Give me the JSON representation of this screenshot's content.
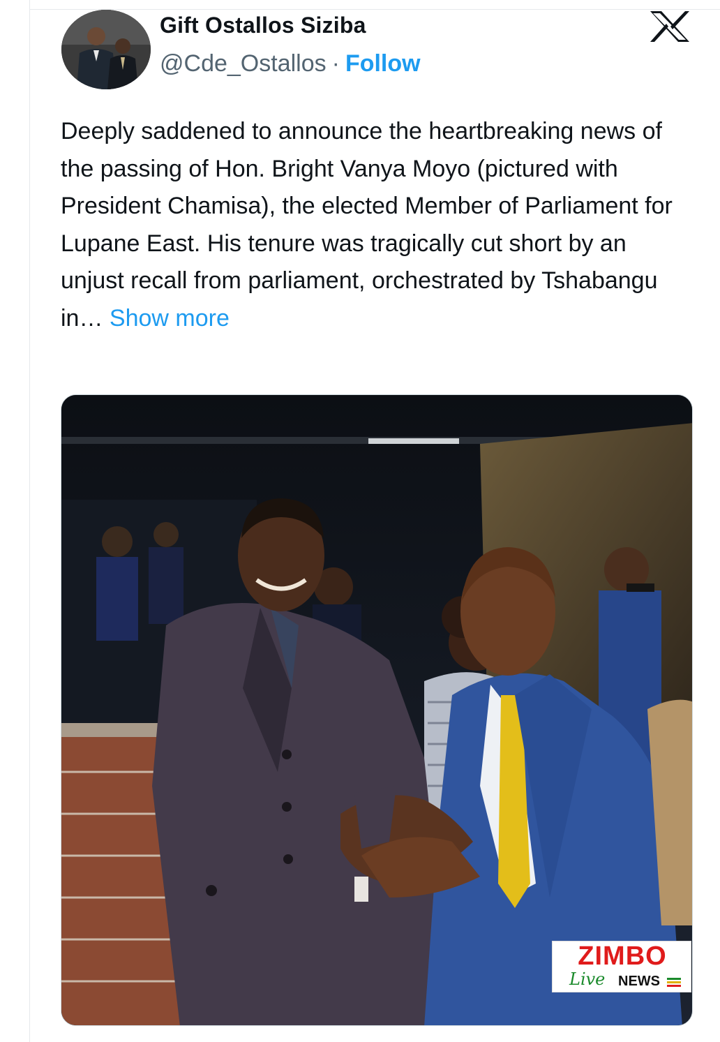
{
  "tweet": {
    "display_name": "Gift Ostallos Siziba",
    "handle": "@Cde_Ostallos",
    "separator": "·",
    "follow_label": "Follow",
    "text": "Deeply saddened to announce the heartbreaking news of the passing of Hon. Bright Vanya Moyo (pictured with President Chamisa), the elected Member of Parliament for Lupane East. His tenure was tragically cut short by an unjust recall from parliament, orchestrated by Tshabangu in…",
    "show_more_label": "Show more"
  },
  "brand": {
    "icon": "x-logo-icon"
  },
  "watermark": {
    "top": "ZIMBO",
    "live": "Live",
    "news": "NEWS"
  },
  "colors": {
    "accent": "#1d9bf0",
    "text": "#0f1419",
    "secondary": "#536471",
    "watermark_red": "#e01b1b",
    "watermark_green": "#1a8a2b"
  }
}
